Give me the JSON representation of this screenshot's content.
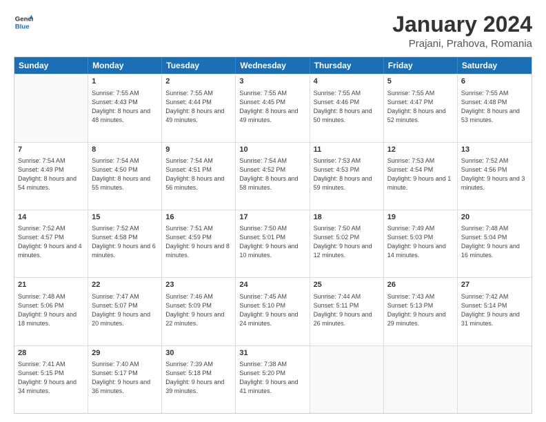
{
  "logo": {
    "line1": "General",
    "line2": "Blue"
  },
  "title": "January 2024",
  "subtitle": "Prajani, Prahova, Romania",
  "days_of_week": [
    "Sunday",
    "Monday",
    "Tuesday",
    "Wednesday",
    "Thursday",
    "Friday",
    "Saturday"
  ],
  "weeks": [
    [
      {
        "day": "",
        "sunrise": "",
        "sunset": "",
        "daylight": ""
      },
      {
        "day": "1",
        "sunrise": "Sunrise: 7:55 AM",
        "sunset": "Sunset: 4:43 PM",
        "daylight": "Daylight: 8 hours and 48 minutes."
      },
      {
        "day": "2",
        "sunrise": "Sunrise: 7:55 AM",
        "sunset": "Sunset: 4:44 PM",
        "daylight": "Daylight: 8 hours and 49 minutes."
      },
      {
        "day": "3",
        "sunrise": "Sunrise: 7:55 AM",
        "sunset": "Sunset: 4:45 PM",
        "daylight": "Daylight: 8 hours and 49 minutes."
      },
      {
        "day": "4",
        "sunrise": "Sunrise: 7:55 AM",
        "sunset": "Sunset: 4:46 PM",
        "daylight": "Daylight: 8 hours and 50 minutes."
      },
      {
        "day": "5",
        "sunrise": "Sunrise: 7:55 AM",
        "sunset": "Sunset: 4:47 PM",
        "daylight": "Daylight: 8 hours and 52 minutes."
      },
      {
        "day": "6",
        "sunrise": "Sunrise: 7:55 AM",
        "sunset": "Sunset: 4:48 PM",
        "daylight": "Daylight: 8 hours and 53 minutes."
      }
    ],
    [
      {
        "day": "7",
        "sunrise": "Sunrise: 7:54 AM",
        "sunset": "Sunset: 4:49 PM",
        "daylight": "Daylight: 8 hours and 54 minutes."
      },
      {
        "day": "8",
        "sunrise": "Sunrise: 7:54 AM",
        "sunset": "Sunset: 4:50 PM",
        "daylight": "Daylight: 8 hours and 55 minutes."
      },
      {
        "day": "9",
        "sunrise": "Sunrise: 7:54 AM",
        "sunset": "Sunset: 4:51 PM",
        "daylight": "Daylight: 8 hours and 56 minutes."
      },
      {
        "day": "10",
        "sunrise": "Sunrise: 7:54 AM",
        "sunset": "Sunset: 4:52 PM",
        "daylight": "Daylight: 8 hours and 58 minutes."
      },
      {
        "day": "11",
        "sunrise": "Sunrise: 7:53 AM",
        "sunset": "Sunset: 4:53 PM",
        "daylight": "Daylight: 8 hours and 59 minutes."
      },
      {
        "day": "12",
        "sunrise": "Sunrise: 7:53 AM",
        "sunset": "Sunset: 4:54 PM",
        "daylight": "Daylight: 9 hours and 1 minute."
      },
      {
        "day": "13",
        "sunrise": "Sunrise: 7:52 AM",
        "sunset": "Sunset: 4:56 PM",
        "daylight": "Daylight: 9 hours and 3 minutes."
      }
    ],
    [
      {
        "day": "14",
        "sunrise": "Sunrise: 7:52 AM",
        "sunset": "Sunset: 4:57 PM",
        "daylight": "Daylight: 9 hours and 4 minutes."
      },
      {
        "day": "15",
        "sunrise": "Sunrise: 7:52 AM",
        "sunset": "Sunset: 4:58 PM",
        "daylight": "Daylight: 9 hours and 6 minutes."
      },
      {
        "day": "16",
        "sunrise": "Sunrise: 7:51 AM",
        "sunset": "Sunset: 4:59 PM",
        "daylight": "Daylight: 9 hours and 8 minutes."
      },
      {
        "day": "17",
        "sunrise": "Sunrise: 7:50 AM",
        "sunset": "Sunset: 5:01 PM",
        "daylight": "Daylight: 9 hours and 10 minutes."
      },
      {
        "day": "18",
        "sunrise": "Sunrise: 7:50 AM",
        "sunset": "Sunset: 5:02 PM",
        "daylight": "Daylight: 9 hours and 12 minutes."
      },
      {
        "day": "19",
        "sunrise": "Sunrise: 7:49 AM",
        "sunset": "Sunset: 5:03 PM",
        "daylight": "Daylight: 9 hours and 14 minutes."
      },
      {
        "day": "20",
        "sunrise": "Sunrise: 7:48 AM",
        "sunset": "Sunset: 5:04 PM",
        "daylight": "Daylight: 9 hours and 16 minutes."
      }
    ],
    [
      {
        "day": "21",
        "sunrise": "Sunrise: 7:48 AM",
        "sunset": "Sunset: 5:06 PM",
        "daylight": "Daylight: 9 hours and 18 minutes."
      },
      {
        "day": "22",
        "sunrise": "Sunrise: 7:47 AM",
        "sunset": "Sunset: 5:07 PM",
        "daylight": "Daylight: 9 hours and 20 minutes."
      },
      {
        "day": "23",
        "sunrise": "Sunrise: 7:46 AM",
        "sunset": "Sunset: 5:09 PM",
        "daylight": "Daylight: 9 hours and 22 minutes."
      },
      {
        "day": "24",
        "sunrise": "Sunrise: 7:45 AM",
        "sunset": "Sunset: 5:10 PM",
        "daylight": "Daylight: 9 hours and 24 minutes."
      },
      {
        "day": "25",
        "sunrise": "Sunrise: 7:44 AM",
        "sunset": "Sunset: 5:11 PM",
        "daylight": "Daylight: 9 hours and 26 minutes."
      },
      {
        "day": "26",
        "sunrise": "Sunrise: 7:43 AM",
        "sunset": "Sunset: 5:13 PM",
        "daylight": "Daylight: 9 hours and 29 minutes."
      },
      {
        "day": "27",
        "sunrise": "Sunrise: 7:42 AM",
        "sunset": "Sunset: 5:14 PM",
        "daylight": "Daylight: 9 hours and 31 minutes."
      }
    ],
    [
      {
        "day": "28",
        "sunrise": "Sunrise: 7:41 AM",
        "sunset": "Sunset: 5:15 PM",
        "daylight": "Daylight: 9 hours and 34 minutes."
      },
      {
        "day": "29",
        "sunrise": "Sunrise: 7:40 AM",
        "sunset": "Sunset: 5:17 PM",
        "daylight": "Daylight: 9 hours and 36 minutes."
      },
      {
        "day": "30",
        "sunrise": "Sunrise: 7:39 AM",
        "sunset": "Sunset: 5:18 PM",
        "daylight": "Daylight: 9 hours and 39 minutes."
      },
      {
        "day": "31",
        "sunrise": "Sunrise: 7:38 AM",
        "sunset": "Sunset: 5:20 PM",
        "daylight": "Daylight: 9 hours and 41 minutes."
      },
      {
        "day": "",
        "sunrise": "",
        "sunset": "",
        "daylight": ""
      },
      {
        "day": "",
        "sunrise": "",
        "sunset": "",
        "daylight": ""
      },
      {
        "day": "",
        "sunrise": "",
        "sunset": "",
        "daylight": ""
      }
    ]
  ]
}
